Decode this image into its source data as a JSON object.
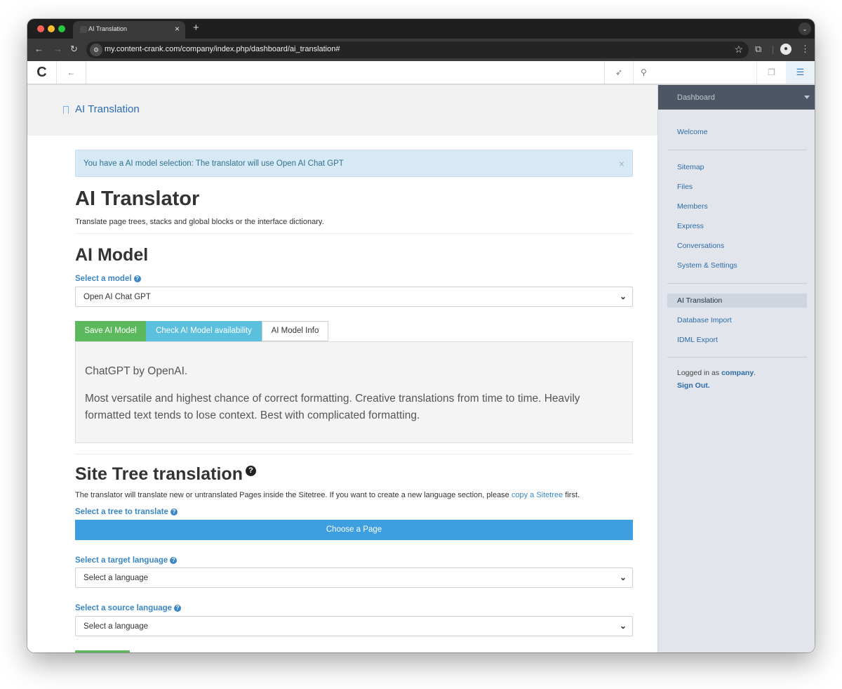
{
  "browser": {
    "tab_title": "AI Translation",
    "tab_close": "×",
    "new_tab": "+",
    "url": "my.content-crank.com/company/index.php/dashboard/ai_translation#"
  },
  "cms": {
    "search_placeholder": ""
  },
  "page": {
    "header_title": "AI Translation",
    "alert_text": "You have a AI model selection: The translator will use Open AI Chat GPT",
    "alert_close": "×",
    "h1": "AI Translator",
    "lead": "Translate page trees, stacks and global blocks or the interface dictionary.",
    "ai_model": {
      "heading": "AI Model",
      "select_label": "Select a model",
      "selected_value": "Open AI Chat GPT",
      "save_button": "Save AI Model",
      "check_button": "Check AI Model availability",
      "info_button": "AI Model Info",
      "info_title": "ChatGPT by OpenAI.",
      "info_desc": "Most versatile and highest chance of correct formatting. Creative translations from time to time. Heavily formatted text tends to lose context. Best with complicated formatting."
    },
    "site_tree": {
      "heading": "Site Tree translation",
      "para_before": "The translator will translate new or untranslated Pages inside the Sitetree. If you want to create a new language section, please ",
      "para_link": "copy a Sitetree",
      "para_after": " first.",
      "tree_label": "Select a tree to translate",
      "choose_button": "Choose a Page",
      "target_label": "Select a target language",
      "target_value": "Select a language",
      "source_label": "Select a source language",
      "source_value": "Select a language"
    }
  },
  "sidebar": {
    "header": "Dashboard",
    "group1": [
      "Welcome"
    ],
    "group2": [
      "Sitemap",
      "Files",
      "Members",
      "Express",
      "Conversations",
      "System & Settings"
    ],
    "active": "AI Translation",
    "group3": [
      "Database Import",
      "IDML Export"
    ],
    "logged_in_prefix": "Logged in as ",
    "logged_in_user": "company",
    "logged_in_suffix": ".",
    "sign_out": "Sign Out."
  }
}
